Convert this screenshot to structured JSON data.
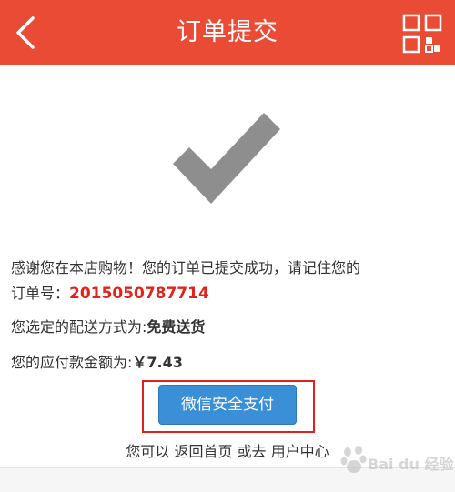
{
  "header": {
    "title": "订单提交",
    "back_icon": "chevron-left-icon",
    "menu_icon": "grid-icon",
    "background_color": "#e94b35"
  },
  "success_icon": "checkmark-icon",
  "message": {
    "thanks": "感谢您在本店购物！您的订单已提交成功，请记住您的",
    "order_label": "订单号：",
    "order_number": "2015050787714",
    "shipping_label": "您选定的配送方式为:",
    "shipping_value": "免费送货",
    "amount_label": "您的应付款金额为:",
    "amount_value": "￥7.43"
  },
  "pay_button": {
    "label": "微信安全支付",
    "color": "#3a8fd6"
  },
  "footer": {
    "prefix": "您可以",
    "home_link": "返回首页",
    "middle": "或去",
    "user_center_link": "用户中心"
  },
  "watermark": {
    "text": "Bai du 经验"
  }
}
